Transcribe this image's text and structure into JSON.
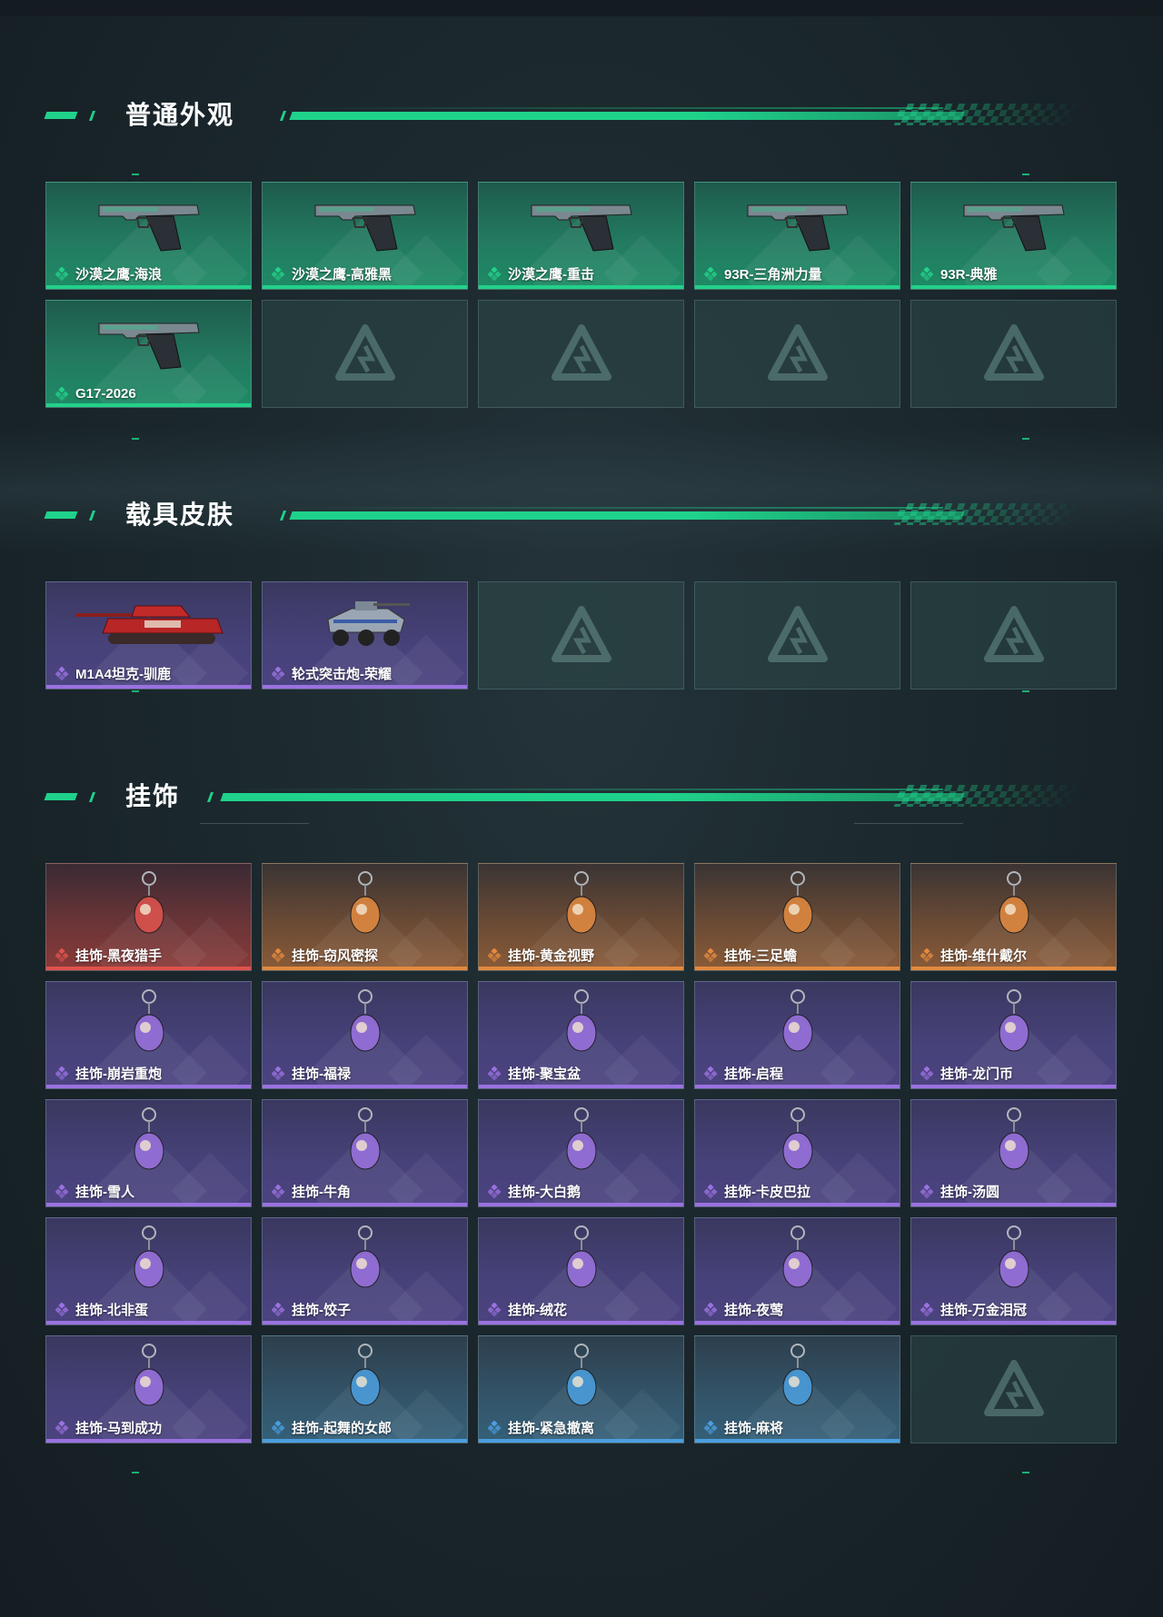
{
  "colors": {
    "accent": "#1fd28b",
    "rarity_green": "#23d08a",
    "rarity_purple": "#9b72e0",
    "rarity_red": "#e0524d",
    "rarity_orange": "#e38a3f",
    "rarity_blue": "#4b9fe0"
  },
  "sections": {
    "normal": {
      "title": "普通外观",
      "items": [
        {
          "name": "沙漠之鹰-海浪",
          "rarity": "green",
          "icon": "pistol-icon"
        },
        {
          "name": "沙漠之鹰-高雅黑",
          "rarity": "green",
          "icon": "pistol-icon"
        },
        {
          "name": "沙漠之鹰-重击",
          "rarity": "green",
          "icon": "pistol-icon"
        },
        {
          "name": "93R-三角洲力量",
          "rarity": "green",
          "icon": "pistol-icon"
        },
        {
          "name": "93R-典雅",
          "rarity": "green",
          "icon": "pistol-icon"
        },
        {
          "name": "G17-2026",
          "rarity": "green",
          "icon": "pistol-icon"
        }
      ]
    },
    "vehicle": {
      "title": "载具皮肤",
      "items": [
        {
          "name": "M1A4坦克-驯鹿",
          "rarity": "purple",
          "icon": "tank-icon"
        },
        {
          "name": "轮式突击炮-荣耀",
          "rarity": "purple",
          "icon": "armored-vehicle-icon"
        }
      ]
    },
    "charm": {
      "title": "挂饰",
      "items": [
        {
          "name": "挂饰-黑夜猎手",
          "rarity": "red",
          "icon": "charm-icon"
        },
        {
          "name": "挂饰-窃风密探",
          "rarity": "orange",
          "icon": "charm-icon"
        },
        {
          "name": "挂饰-黄金视野",
          "rarity": "orange",
          "icon": "charm-icon"
        },
        {
          "name": "挂饰-三足蟾",
          "rarity": "orange",
          "icon": "charm-icon"
        },
        {
          "name": "挂饰-维什戴尔",
          "rarity": "orange",
          "icon": "charm-icon"
        },
        {
          "name": "挂饰-崩岩重炮",
          "rarity": "purple",
          "icon": "charm-icon"
        },
        {
          "name": "挂饰-福禄",
          "rarity": "purple",
          "icon": "charm-icon"
        },
        {
          "name": "挂饰-聚宝盆",
          "rarity": "purple",
          "icon": "charm-icon"
        },
        {
          "name": "挂饰-启程",
          "rarity": "purple",
          "icon": "charm-icon"
        },
        {
          "name": "挂饰-龙门币",
          "rarity": "purple",
          "icon": "charm-icon"
        },
        {
          "name": "挂饰-雪人",
          "rarity": "purple",
          "icon": "charm-icon"
        },
        {
          "name": "挂饰-牛角",
          "rarity": "purple",
          "icon": "charm-icon"
        },
        {
          "name": "挂饰-大白鹅",
          "rarity": "purple",
          "icon": "charm-icon"
        },
        {
          "name": "挂饰-卡皮巴拉",
          "rarity": "purple",
          "icon": "charm-icon"
        },
        {
          "name": "挂饰-汤圆",
          "rarity": "purple",
          "icon": "charm-icon"
        },
        {
          "name": "挂饰-北非蛋",
          "rarity": "purple",
          "icon": "charm-icon"
        },
        {
          "name": "挂饰-饺子",
          "rarity": "purple",
          "icon": "charm-icon"
        },
        {
          "name": "挂饰-绒花",
          "rarity": "purple",
          "icon": "charm-icon"
        },
        {
          "name": "挂饰-夜莺",
          "rarity": "purple",
          "icon": "charm-icon"
        },
        {
          "name": "挂饰-万金泪冠",
          "rarity": "purple",
          "icon": "charm-icon"
        },
        {
          "name": "挂饰-马到成功",
          "rarity": "purple",
          "icon": "charm-icon"
        },
        {
          "name": "挂饰-起舞的女郎",
          "rarity": "blue",
          "icon": "charm-icon"
        },
        {
          "name": "挂饰-紧急撤离",
          "rarity": "blue",
          "icon": "charm-icon"
        },
        {
          "name": "挂饰-麻将",
          "rarity": "blue",
          "icon": "charm-icon"
        }
      ]
    }
  }
}
